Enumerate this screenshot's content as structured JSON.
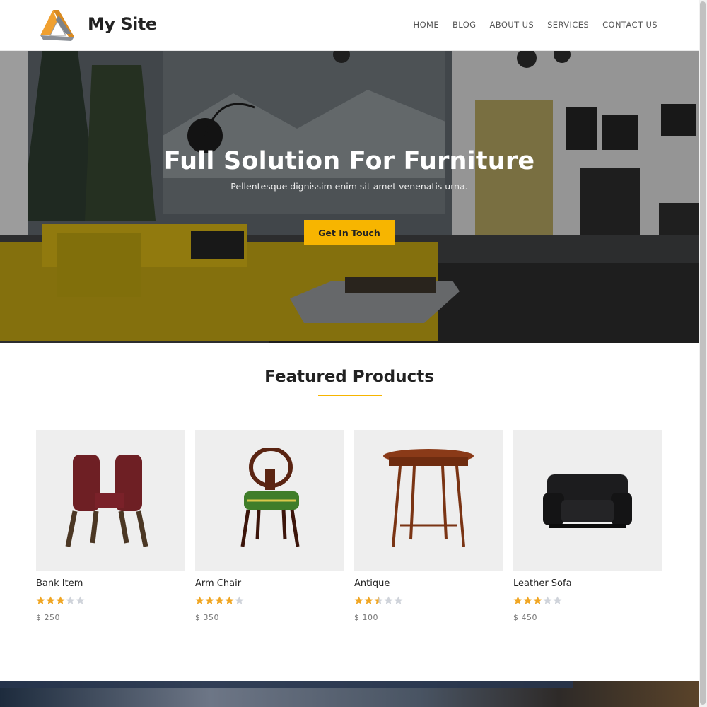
{
  "site": {
    "name": "My Site",
    "logo_icon": "triangle-logo-icon",
    "accent_color": "#f7b500"
  },
  "nav": {
    "items": [
      "HOME",
      "BLOG",
      "ABOUT US",
      "SERVICES",
      "CONTACT US"
    ]
  },
  "hero": {
    "title": "Full Solution For Furniture",
    "subtitle": "Pellentesque dignissim enim sit amet venenatis urna.",
    "button": "Get In Touch"
  },
  "featured": {
    "title": "Featured Products",
    "products": [
      {
        "name": "Bank Item",
        "rating": 3,
        "price": "$ 250",
        "icon": "bench-icon"
      },
      {
        "name": "Arm Chair",
        "rating": 4,
        "price": "$ 350",
        "icon": "chair-icon"
      },
      {
        "name": "Antique",
        "rating": 2.5,
        "price": "$ 100",
        "icon": "table-icon"
      },
      {
        "name": "Leather Sofa",
        "rating": 3,
        "price": "$ 450",
        "icon": "sofa-icon"
      }
    ]
  },
  "colors": {
    "star_filled": "#f0a623",
    "star_empty": "#cfd3da"
  }
}
